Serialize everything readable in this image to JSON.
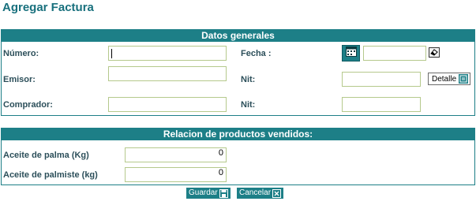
{
  "page": {
    "title": "Agregar Factura"
  },
  "general": {
    "header": "Datos generales",
    "numero_label": "Número:",
    "numero_value": "",
    "fecha_label": "Fecha :",
    "fecha_value": "",
    "emisor_label": "Emisor:",
    "emisor_value": "",
    "nit_emisor_label": "Nit:",
    "nit_emisor_value": "",
    "detalle_label": "Detalle",
    "comprador_label": "Comprador:",
    "comprador_value": "",
    "nit_comprador_label": "Nit:",
    "nit_comprador_value": ""
  },
  "productos": {
    "header": "Relacion de productos vendidos:",
    "items": [
      {
        "label": "Aceite de palma (Kg)",
        "value": "0"
      },
      {
        "label": "Aceite de palmiste (kg)",
        "value": "0"
      }
    ]
  },
  "actions": {
    "save_label": "Guardar",
    "cancel_label": "Cancelar"
  },
  "icons": {
    "calendar": "calendar-icon",
    "eraser": "eraser-icon",
    "detail": "detail-icon",
    "save": "floppy-icon",
    "cancel": "close-icon"
  }
}
